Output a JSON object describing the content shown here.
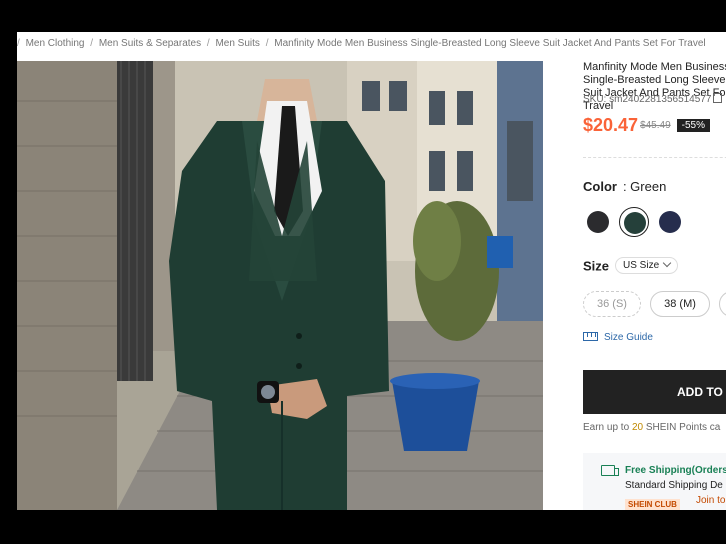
{
  "breadcrumb": {
    "items": [
      {
        "label": "Men Clothing"
      },
      {
        "label": "Men Suits & Separates"
      },
      {
        "label": "Men Suits"
      },
      {
        "label": "Manfinity Mode Men Business Single-Breasted Long Sleeve Suit Jacket And Pants Set For Travel"
      }
    ],
    "separator": "/"
  },
  "product": {
    "title": "Manfinity Mode Men Business Single-Breasted Long Sleeve Suit Jacket And Pants Set For Travel",
    "sku": "SKU: sm2402281356514577",
    "price": "$20.47",
    "original_price": "$45.49",
    "discount": "-55%"
  },
  "color": {
    "label": "Color",
    "value": ": Green",
    "swatches": [
      {
        "name": "Black",
        "hex": "#2b2b2e",
        "selected": false
      },
      {
        "name": "Green",
        "hex": "#25403a",
        "selected": true
      },
      {
        "name": "Navy",
        "hex": "#262d4d",
        "selected": false
      }
    ]
  },
  "size": {
    "label": "Size",
    "unit_selector": "US Size",
    "options": [
      {
        "label": "36 (S)",
        "available": false
      },
      {
        "label": "38 (M)",
        "available": true
      }
    ],
    "guide_label": "Size Guide"
  },
  "actions": {
    "add_to_bag": "ADD TO"
  },
  "points": {
    "prefix": "Earn up to",
    "amount": "20",
    "suffix": "SHEIN Points ca"
  },
  "shipping": {
    "title": "Free Shipping(Orders",
    "standard": "Standard Shipping De",
    "club_badge": "SHEIN CLUB",
    "join": "Join to"
  },
  "colors": {
    "accent_price": "#fa6338",
    "button_bg": "#222222",
    "link": "#2d68a8",
    "shipping_green": "#198055"
  }
}
